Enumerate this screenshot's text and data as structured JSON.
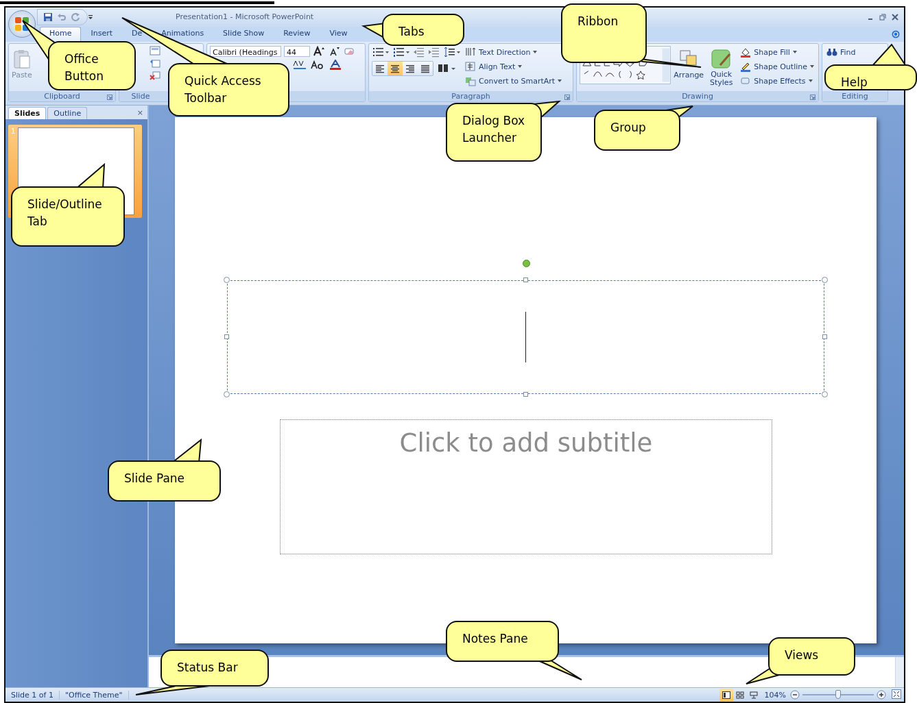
{
  "window": {
    "title": "Presentation1 - Microsoft PowerPoint"
  },
  "tabs": [
    {
      "label": "Home",
      "selected": true
    },
    {
      "label": "Insert",
      "selected": false
    },
    {
      "label": "De",
      "selected": false
    },
    {
      "label": "Animations",
      "selected": false
    },
    {
      "label": "Slide Show",
      "selected": false
    },
    {
      "label": "Review",
      "selected": false
    },
    {
      "label": "View",
      "selected": false
    }
  ],
  "ribbon": {
    "clipboard": {
      "paste": "Paste",
      "label": "Clipboard"
    },
    "slides": {
      "label": "Slide"
    },
    "font": {
      "font": "Calibri (Headings",
      "size": "44"
    },
    "paragraph": {
      "alignments": [
        {
          "selected": false
        },
        {
          "selected": true
        },
        {
          "selected": false
        },
        {
          "selected": false
        }
      ],
      "commands": [
        "Text Direction",
        "Align Text",
        "Convert to SmartArt"
      ],
      "label": "Paragraph"
    },
    "drawing": {
      "arrange": "Arrange",
      "quick_styles": "Quick Styles",
      "commands": [
        "Shape Fill",
        "Shape Outline",
        "Shape Effects"
      ],
      "label": "Drawing"
    },
    "editing": {
      "find": "Find",
      "label": "Editing"
    }
  },
  "slides_pane": {
    "tabs": [
      {
        "label": "Slides",
        "selected": true
      },
      {
        "label": "Outline",
        "selected": false
      }
    ],
    "close": "×",
    "thumbnails": [
      {
        "number": "1",
        "selected": true
      }
    ]
  },
  "slide": {
    "subtitle_placeholder": "Click to add subtitle"
  },
  "status_bar": {
    "items": [
      "Slide 1 of 1",
      "\"Office Theme\""
    ],
    "views": [
      {
        "selected": true
      },
      {
        "selected": false
      },
      {
        "selected": false
      }
    ],
    "zoom": "104%",
    "zoom_slider": {
      "level": 0.5
    }
  },
  "callouts": [
    {
      "text": "Office Button"
    },
    {
      "text": "Quick Access Toolbar"
    },
    {
      "text": "Tabs"
    },
    {
      "text": "Ribbon"
    },
    {
      "text": "Help"
    },
    {
      "text": "Dialog Box Launcher"
    },
    {
      "text": "Group"
    },
    {
      "text": "Slide/Outline Tab"
    },
    {
      "text": "Slide Pane"
    },
    {
      "text": "Notes Pane"
    },
    {
      "text": "Status Bar"
    },
    {
      "text": "Views"
    }
  ]
}
